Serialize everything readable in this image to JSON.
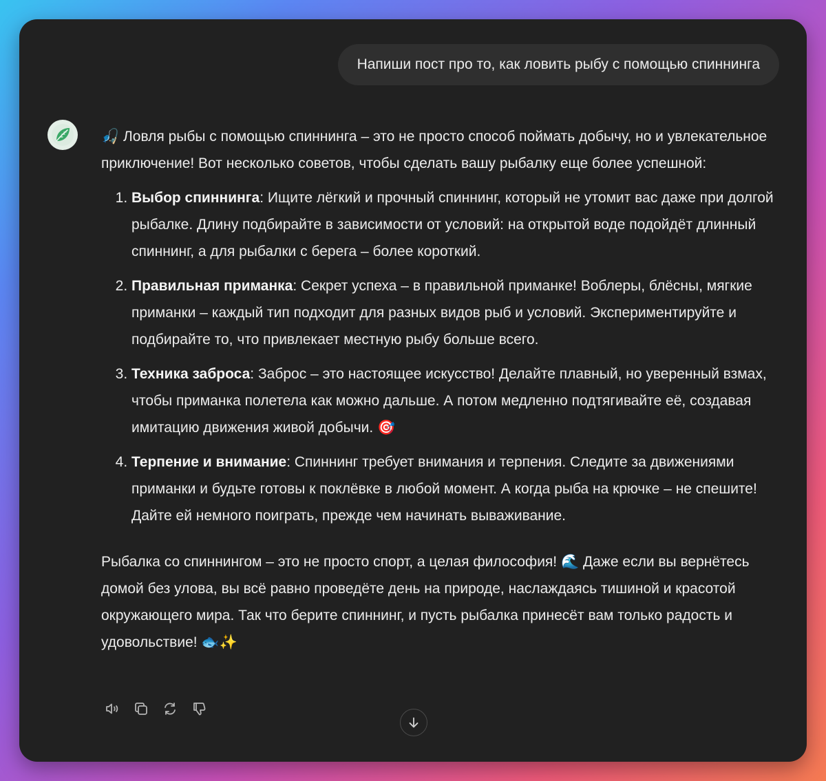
{
  "user_message": "Напиши пост про то, как ловить рыбу с помощью спиннинга",
  "assistant": {
    "avatar_icon": "leaf-icon",
    "intro": "🎣 Ловля рыбы с помощью спиннинга – это не просто способ поймать добычу, но и увлекательное приключение! Вот несколько советов, чтобы сделать вашу рыбалку еще более успешной:",
    "tips": [
      {
        "term": "Выбор спиннинга",
        "text": ": Ищите лёгкий и прочный спиннинг, который не утомит вас даже при долгой рыбалке. Длину подбирайте в зависимости от условий: на открытой воде подойдёт длинный спиннинг, а для рыбалки с берега – более короткий."
      },
      {
        "term": "Правильная приманка",
        "text": ": Секрет успеха – в правильной приманке! Воблеры, блёсны, мягкие приманки – каждый тип подходит для разных видов рыб и условий. Экспериментируйте и подбирайте то, что привлекает местную рыбу больше всего."
      },
      {
        "term": "Техника заброса",
        "text": ": Заброс – это настоящее искусство! Делайте плавный, но уверенный взмах, чтобы приманка полетела как можно дальше. А потом медленно подтягивайте её, создавая имитацию движения живой добычи. 🎯"
      },
      {
        "term": "Терпение и внимание",
        "text": ": Спиннинг требует внимания и терпения. Следите за движениями приманки и будьте готовы к поклёвке в любой момент. А когда рыба на крючке – не спешите! Дайте ей немного поиграть, прежде чем начинать вываживание."
      }
    ],
    "outro": "Рыбалка со спиннингом – это не просто спорт, а целая философия! 🌊 Даже если вы вернётесь домой без улова, вы всё равно проведёте день на природе, наслаждаясь тишиной и красотой окружающего мира. Так что берите спиннинг, и пусть рыбалка принесёт вам только радость и удовольствие! 🐟✨"
  },
  "actions": [
    "speaker-icon",
    "copy-icon",
    "regenerate-icon",
    "thumbs-down-icon"
  ],
  "scroll_button_icon": "arrow-down-icon",
  "colors": {
    "window_bg": "#212121",
    "user_bubble_bg": "#2f2f2f",
    "text": "#ececec",
    "avatar_bg": "#e4efe7",
    "leaf": "#2f9a5a"
  }
}
